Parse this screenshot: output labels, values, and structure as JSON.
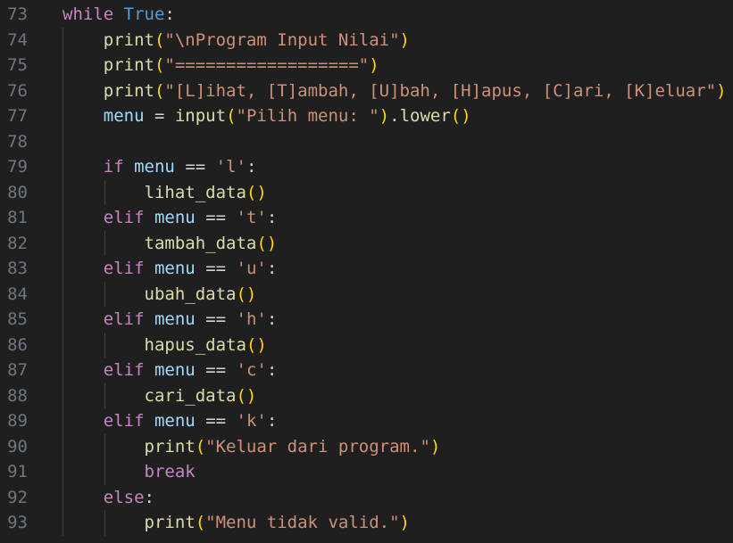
{
  "editor": {
    "language": "python",
    "colors": {
      "background": "#1f1f1f",
      "line_number": "#6e7681",
      "keyword_control": "#c586c0",
      "keyword_constant": "#569cd6",
      "function": "#dcdcaa",
      "string": "#ce9178",
      "variable": "#9cdcfe",
      "bracket_level1": "#ffd700",
      "bracket_level2": "#da70d6"
    },
    "lines": [
      {
        "num": "73",
        "tokens": [
          {
            "t": "while",
            "c": "kw-ctrl"
          },
          {
            "t": " ",
            "c": "plain"
          },
          {
            "t": "True",
            "c": "kw-const"
          },
          {
            "t": ":",
            "c": "op"
          }
        ]
      },
      {
        "num": "74",
        "tokens": [
          {
            "t": "    ",
            "c": "plain"
          },
          {
            "t": "print",
            "c": "fn"
          },
          {
            "t": "(",
            "c": "p1"
          },
          {
            "t": "\"\\nProgram Input Nilai\"",
            "c": "str"
          },
          {
            "t": ")",
            "c": "p1"
          }
        ]
      },
      {
        "num": "75",
        "tokens": [
          {
            "t": "    ",
            "c": "plain"
          },
          {
            "t": "print",
            "c": "fn"
          },
          {
            "t": "(",
            "c": "p1"
          },
          {
            "t": "\"==================\"",
            "c": "str"
          },
          {
            "t": ")",
            "c": "p1"
          }
        ]
      },
      {
        "num": "76",
        "tokens": [
          {
            "t": "    ",
            "c": "plain"
          },
          {
            "t": "print",
            "c": "fn"
          },
          {
            "t": "(",
            "c": "p1"
          },
          {
            "t": "\"[L]ihat, [T]ambah, [U]bah, [H]apus, [C]ari, [K]eluar\"",
            "c": "str"
          },
          {
            "t": ")",
            "c": "p1"
          }
        ]
      },
      {
        "num": "77",
        "tokens": [
          {
            "t": "    ",
            "c": "plain"
          },
          {
            "t": "menu",
            "c": "var"
          },
          {
            "t": " = ",
            "c": "op"
          },
          {
            "t": "input",
            "c": "fn"
          },
          {
            "t": "(",
            "c": "p1"
          },
          {
            "t": "\"Pilih menu: \"",
            "c": "str"
          },
          {
            "t": ")",
            "c": "p1"
          },
          {
            "t": ".",
            "c": "op"
          },
          {
            "t": "lower",
            "c": "fn"
          },
          {
            "t": "()",
            "c": "p1"
          }
        ]
      },
      {
        "num": "78",
        "tokens": []
      },
      {
        "num": "79",
        "tokens": [
          {
            "t": "    ",
            "c": "plain"
          },
          {
            "t": "if",
            "c": "kw-ctrl"
          },
          {
            "t": " ",
            "c": "plain"
          },
          {
            "t": "menu",
            "c": "var"
          },
          {
            "t": " == ",
            "c": "op"
          },
          {
            "t": "'l'",
            "c": "str"
          },
          {
            "t": ":",
            "c": "op"
          }
        ]
      },
      {
        "num": "80",
        "tokens": [
          {
            "t": "        ",
            "c": "plain"
          },
          {
            "t": "lihat_data",
            "c": "fn"
          },
          {
            "t": "()",
            "c": "p1"
          }
        ]
      },
      {
        "num": "81",
        "tokens": [
          {
            "t": "    ",
            "c": "plain"
          },
          {
            "t": "elif",
            "c": "kw-ctrl"
          },
          {
            "t": " ",
            "c": "plain"
          },
          {
            "t": "menu",
            "c": "var"
          },
          {
            "t": " == ",
            "c": "op"
          },
          {
            "t": "'t'",
            "c": "str"
          },
          {
            "t": ":",
            "c": "op"
          }
        ]
      },
      {
        "num": "82",
        "tokens": [
          {
            "t": "        ",
            "c": "plain"
          },
          {
            "t": "tambah_data",
            "c": "fn"
          },
          {
            "t": "()",
            "c": "p1"
          }
        ]
      },
      {
        "num": "83",
        "tokens": [
          {
            "t": "    ",
            "c": "plain"
          },
          {
            "t": "elif",
            "c": "kw-ctrl"
          },
          {
            "t": " ",
            "c": "plain"
          },
          {
            "t": "menu",
            "c": "var"
          },
          {
            "t": " == ",
            "c": "op"
          },
          {
            "t": "'u'",
            "c": "str"
          },
          {
            "t": ":",
            "c": "op"
          }
        ]
      },
      {
        "num": "84",
        "tokens": [
          {
            "t": "        ",
            "c": "plain"
          },
          {
            "t": "ubah_data",
            "c": "fn"
          },
          {
            "t": "()",
            "c": "p1"
          }
        ]
      },
      {
        "num": "85",
        "tokens": [
          {
            "t": "    ",
            "c": "plain"
          },
          {
            "t": "elif",
            "c": "kw-ctrl"
          },
          {
            "t": " ",
            "c": "plain"
          },
          {
            "t": "menu",
            "c": "var"
          },
          {
            "t": " == ",
            "c": "op"
          },
          {
            "t": "'h'",
            "c": "str"
          },
          {
            "t": ":",
            "c": "op"
          }
        ]
      },
      {
        "num": "86",
        "tokens": [
          {
            "t": "        ",
            "c": "plain"
          },
          {
            "t": "hapus_data",
            "c": "fn"
          },
          {
            "t": "()",
            "c": "p1"
          }
        ]
      },
      {
        "num": "87",
        "tokens": [
          {
            "t": "    ",
            "c": "plain"
          },
          {
            "t": "elif",
            "c": "kw-ctrl"
          },
          {
            "t": " ",
            "c": "plain"
          },
          {
            "t": "menu",
            "c": "var"
          },
          {
            "t": " == ",
            "c": "op"
          },
          {
            "t": "'c'",
            "c": "str"
          },
          {
            "t": ":",
            "c": "op"
          }
        ]
      },
      {
        "num": "88",
        "tokens": [
          {
            "t": "        ",
            "c": "plain"
          },
          {
            "t": "cari_data",
            "c": "fn"
          },
          {
            "t": "()",
            "c": "p1"
          }
        ]
      },
      {
        "num": "89",
        "tokens": [
          {
            "t": "    ",
            "c": "plain"
          },
          {
            "t": "elif",
            "c": "kw-ctrl"
          },
          {
            "t": " ",
            "c": "plain"
          },
          {
            "t": "menu",
            "c": "var"
          },
          {
            "t": " == ",
            "c": "op"
          },
          {
            "t": "'k'",
            "c": "str"
          },
          {
            "t": ":",
            "c": "op"
          }
        ]
      },
      {
        "num": "90",
        "tokens": [
          {
            "t": "        ",
            "c": "plain"
          },
          {
            "t": "print",
            "c": "fn"
          },
          {
            "t": "(",
            "c": "p1"
          },
          {
            "t": "\"Keluar dari program.\"",
            "c": "str"
          },
          {
            "t": ")",
            "c": "p1"
          }
        ]
      },
      {
        "num": "91",
        "tokens": [
          {
            "t": "        ",
            "c": "plain"
          },
          {
            "t": "break",
            "c": "kw-ctrl"
          }
        ]
      },
      {
        "num": "92",
        "tokens": [
          {
            "t": "    ",
            "c": "plain"
          },
          {
            "t": "else",
            "c": "kw-ctrl"
          },
          {
            "t": ":",
            "c": "op"
          }
        ]
      },
      {
        "num": "93",
        "tokens": [
          {
            "t": "        ",
            "c": "plain"
          },
          {
            "t": "print",
            "c": "fn"
          },
          {
            "t": "(",
            "c": "p1"
          },
          {
            "t": "\"Menu tidak valid.\"",
            "c": "str"
          },
          {
            "t": ")",
            "c": "p1"
          }
        ]
      }
    ]
  }
}
